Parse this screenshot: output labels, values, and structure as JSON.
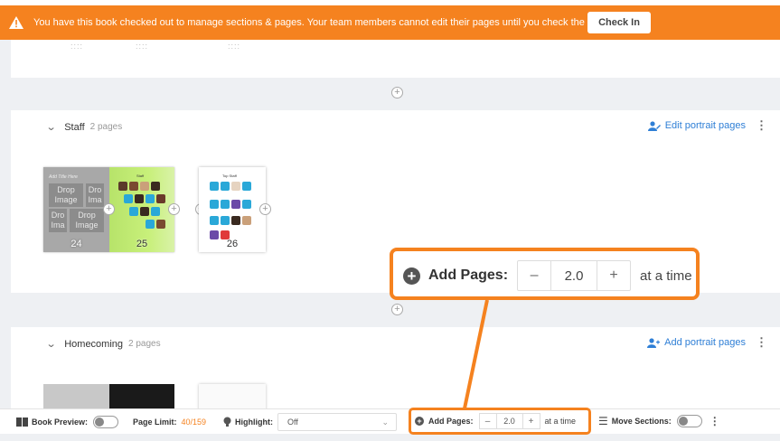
{
  "banner": {
    "message": "You have this book checked out to manage sections & pages. Your team members cannot edit their pages until you check the book in.",
    "check_in_label": "Check In",
    "icon": "warning-icon",
    "color": "#f5821f"
  },
  "sections": [
    {
      "title": "Staff",
      "count": "2 pages",
      "edit_label": "Edit portrait pages",
      "pages": [
        {
          "number": "24",
          "template_title": "Add Title Here",
          "drop_labels": [
            "Drop Image",
            "Dro Ima",
            "Dro Ima",
            "Drop Image"
          ]
        },
        {
          "number": "25",
          "heading": "Staff"
        },
        {
          "number": "26",
          "heading": "Top Staff"
        }
      ]
    },
    {
      "title": "Homecoming",
      "count": "2 pages",
      "edit_label": "Add portrait pages"
    }
  ],
  "callout": {
    "label": "Add Pages:",
    "value": "2.0",
    "suffix": "at a time",
    "minus": "–",
    "plus": "+"
  },
  "toolbar": {
    "book_preview_label": "Book Preview:",
    "page_limit_label": "Page Limit:",
    "page_limit_value": "40/159",
    "highlight_label": "Highlight:",
    "highlight_value": "Off",
    "add_pages_label": "Add Pages:",
    "add_pages_value": "2.0",
    "add_pages_suffix": "at a time",
    "minus": "–",
    "plus": "+",
    "move_sections_label": "Move Sections:"
  },
  "accent_color": "#f5821f",
  "link_color": "#2f7fd6"
}
